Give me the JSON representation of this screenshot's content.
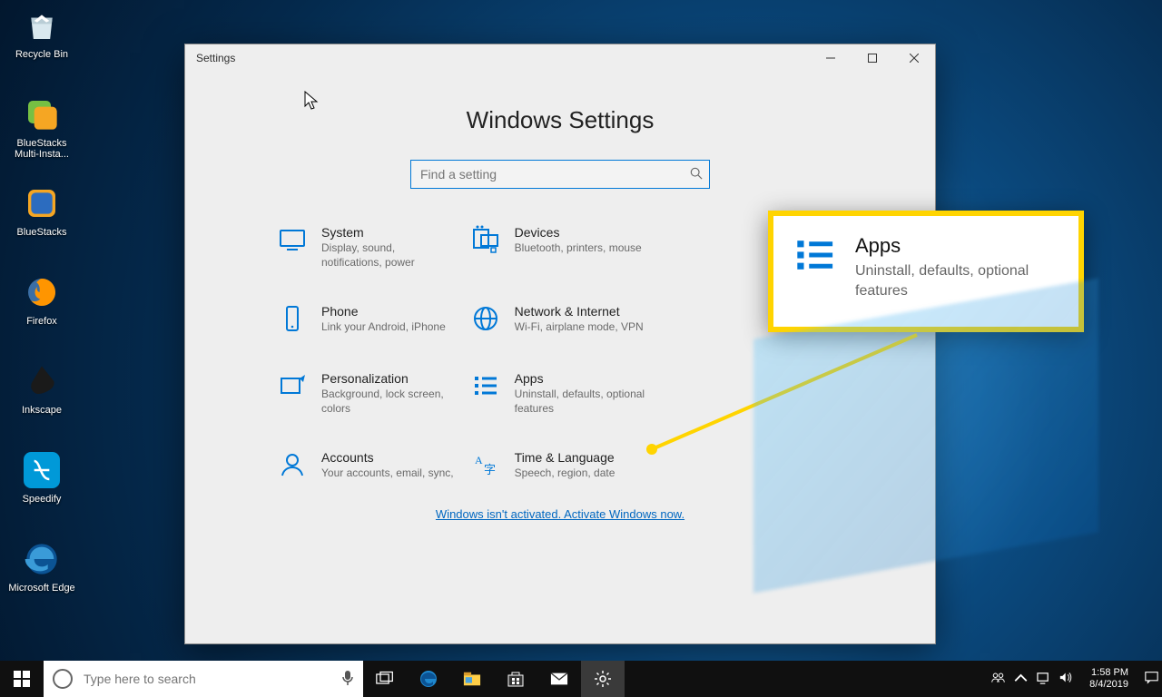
{
  "desktop_icons": [
    {
      "label": "Recycle Bin"
    },
    {
      "label": "BlueStacks Multi-Insta..."
    },
    {
      "label": "BlueStacks"
    },
    {
      "label": "Firefox"
    },
    {
      "label": "Inkscape"
    },
    {
      "label": "Speedify"
    },
    {
      "label": "Microsoft Edge"
    }
  ],
  "settings": {
    "window_title": "Settings",
    "page_title": "Windows Settings",
    "search_placeholder": "Find a setting",
    "activation_link": "Windows isn't activated. Activate Windows now.",
    "categories": [
      {
        "title": "System",
        "desc": "Display, sound, notifications, power"
      },
      {
        "title": "Devices",
        "desc": "Bluetooth, printers, mouse"
      },
      {
        "title": "Phone",
        "desc": "Link your Android, iPhone"
      },
      {
        "title": "Network & Internet",
        "desc": "Wi-Fi, airplane mode, VPN"
      },
      {
        "title": "Personalization",
        "desc": "Background, lock screen, colors"
      },
      {
        "title": "Apps",
        "desc": "Uninstall, defaults, optional features"
      },
      {
        "title": "Accounts",
        "desc": "Your accounts, email, sync,"
      },
      {
        "title": "Time & Language",
        "desc": "Speech, region, date"
      }
    ]
  },
  "callout": {
    "title": "Apps",
    "desc": "Uninstall, defaults, optional features"
  },
  "taskbar": {
    "search_placeholder": "Type here to search",
    "time": "1:58 PM",
    "date": "8/4/2019"
  }
}
